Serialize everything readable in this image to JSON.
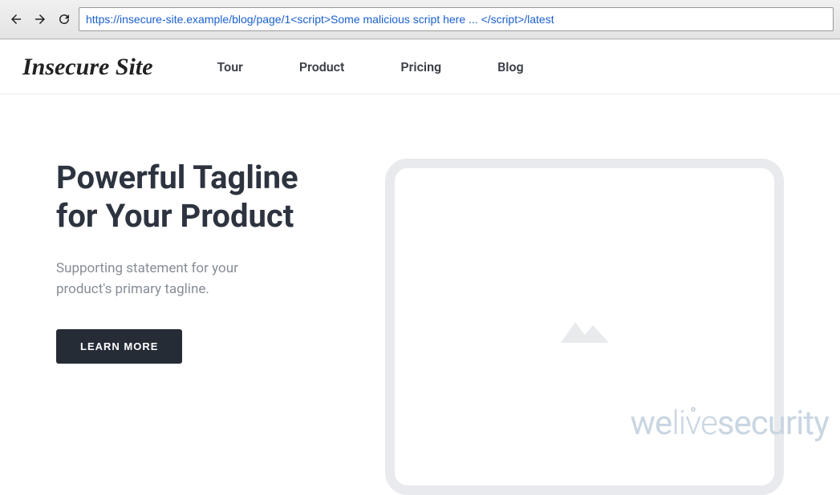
{
  "browser": {
    "url": "https://insecure-site.example/blog/page/1<script>Some malicious script here ... </script>/latest"
  },
  "header": {
    "logo": "Insecure Site",
    "nav": [
      "Tour",
      "Product",
      "Pricing",
      "Blog"
    ]
  },
  "hero": {
    "title": "Powerful Tagline for Your Product",
    "subtitle": "Supporting statement for your product's primary tagline.",
    "cta_label": "LEARN MORE"
  },
  "watermark": {
    "seg1": "we",
    "seg2": "live",
    "seg3": "security"
  }
}
